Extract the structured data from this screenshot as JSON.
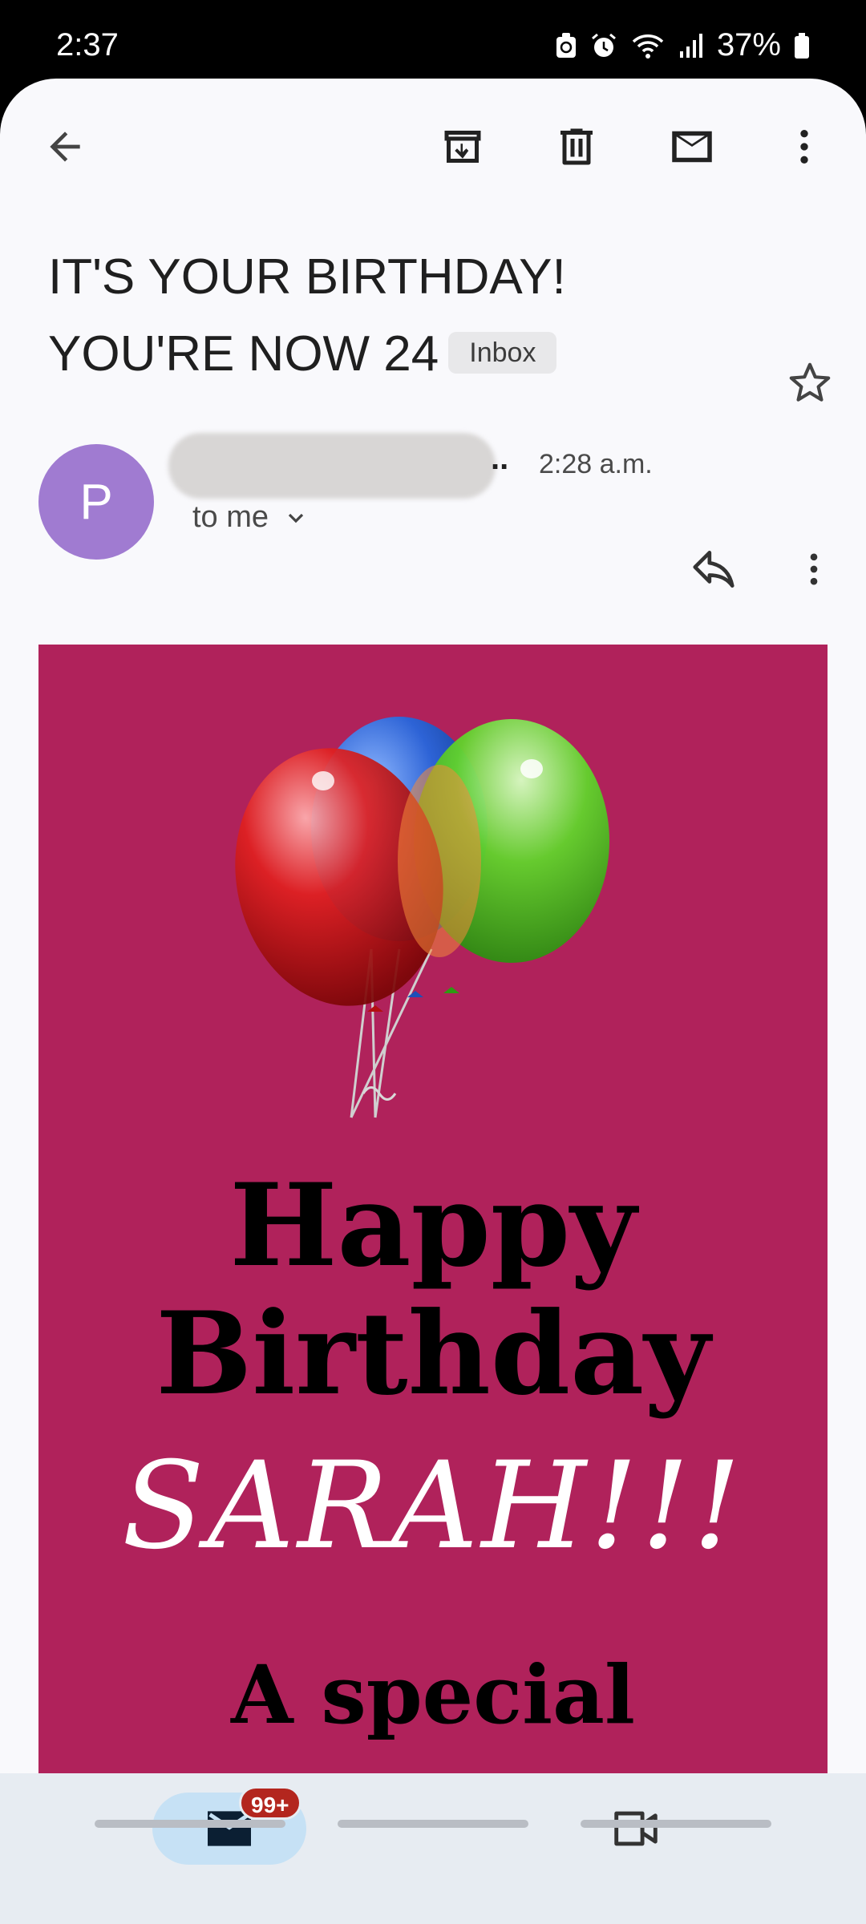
{
  "status_bar": {
    "time": "2:37",
    "battery": "37%",
    "icons": [
      "recycle-icon",
      "alarm-icon",
      "wifi-icon",
      "signal-icon",
      "battery-icon"
    ]
  },
  "toolbar": {
    "icons": [
      "back-arrow-icon",
      "archive-icon",
      "delete-icon",
      "mark-unread-icon",
      "more-vert-icon"
    ]
  },
  "email": {
    "subject": "IT'S YOUR BIRTHDAY! YOU'RE NOW 24",
    "label": "Inbox",
    "sender_initial": "P",
    "sender_ellipsis": "..",
    "time": "2:28 a.m.",
    "recipient": "to me"
  },
  "card": {
    "line1": "Happy",
    "line2": "Birthday",
    "name": "SARAH!!!",
    "next_line": "A special",
    "background": "#b0225b"
  },
  "bottom_nav": {
    "mail_badge": "99+",
    "icons": [
      "mail-icon",
      "video-icon"
    ]
  }
}
